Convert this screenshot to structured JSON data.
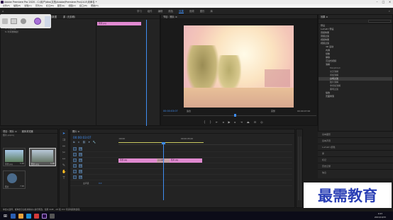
{
  "titlebar": {
    "title": "Adobe Premiere Pro 2020 - C:\\用户\\dbs\\文档\\Adobe\\Premiere Pro\\14.0\\未命名 *"
  },
  "menubar": {
    "items": [
      "文件(F)",
      "编辑(E)",
      "剪辑(C)",
      "序列(S)",
      "标记(M)",
      "图形(G)",
      "视图(V)",
      "窗口(W)",
      "帮助(H)"
    ]
  },
  "workspace": {
    "tabs": [
      "学习",
      "组件",
      "编辑",
      "颜色",
      "效果",
      "音频",
      "图形",
      "库"
    ],
    "active": "效果"
  },
  "effect_controls": {
    "title": "效果控件 ≡",
    "tabs": [
      "音频剪辑混合器：照片",
      "元数据",
      "源（无剪辑）"
    ],
    "rows": [
      "视频",
      "fx 运动",
      "fx 不透明度",
      "fx 时间重映射"
    ],
    "clip_label": "风景.jpg"
  },
  "program_monitor": {
    "title": "节目：照片 ≡",
    "timecode": "00:00:03:07",
    "fit": "适合",
    "quality": "完整",
    "duration": "00:00:07:00"
  },
  "effects_panel": {
    "title": "效果 ≡",
    "items": [
      {
        "label": "预设",
        "type": "folder"
      },
      {
        "label": "Lumetri 预设",
        "type": "folder"
      },
      {
        "label": "音频效果",
        "type": "folder"
      },
      {
        "label": "音频过渡",
        "type": "folder"
      },
      {
        "label": "视频效果",
        "type": "folder"
      },
      {
        "label": "视频过渡",
        "type": "folder"
      },
      {
        "label": "3D 运动",
        "type": "folder"
      },
      {
        "label": "内滑",
        "type": "folder"
      },
      {
        "label": "划像",
        "type": "folder"
      },
      {
        "label": "擦除",
        "type": "folder"
      },
      {
        "label": "沉浸式视频",
        "type": "folder"
      },
      {
        "label": "溶解",
        "type": "folder"
      },
      {
        "label": "MorphCut",
        "type": "item"
      },
      {
        "label": "交叉溶解",
        "type": "item"
      },
      {
        "label": "叠加溶解",
        "type": "item"
      },
      {
        "label": "白场过渡",
        "type": "item",
        "selected": true
      },
      {
        "label": "胶片溶解",
        "type": "item"
      },
      {
        "label": "非叠加溶解",
        "type": "item"
      },
      {
        "label": "黑场过渡",
        "type": "item"
      },
      {
        "label": "缩放",
        "type": "folder"
      },
      {
        "label": "页面剥落",
        "type": "folder"
      }
    ],
    "lower_panels": [
      "基本图形",
      "基本声音",
      "Lumetri 颜色",
      "库",
      "标记",
      "历史记录",
      "信息"
    ]
  },
  "project_panel": {
    "title": "项目：照片 ≡",
    "tab2": "媒体浏览器",
    "file": "照片.prproj",
    "items": [
      "风景.jpg",
      "照片.jpg",
      "照片"
    ],
    "durations": [
      "5:00",
      "5:00",
      "7:00"
    ]
  },
  "timeline": {
    "title": "照片 ≡",
    "timecode": "00:00:03:07",
    "ruler": [
      ":00:00",
      "00:00:05:00"
    ],
    "tracks": [
      "V3",
      "V2",
      "V1",
      "A1",
      "A2",
      "A3",
      "主声道"
    ],
    "clips": [
      {
        "label": "风景.jpg"
      },
      {
        "label": "交叉溶解"
      },
      {
        "label": "照片.jpg"
      }
    ],
    "master_value": "0.0"
  },
  "statusbar": {
    "text": "单击以选择，或单击空白处并拖动以进行框选。使用 Shift、Alt 和 Ctrl 可获得其他选项。"
  },
  "watermark": "最需教育",
  "taskbar": {
    "time": "9:23",
    "date": "2021/10/15"
  }
}
